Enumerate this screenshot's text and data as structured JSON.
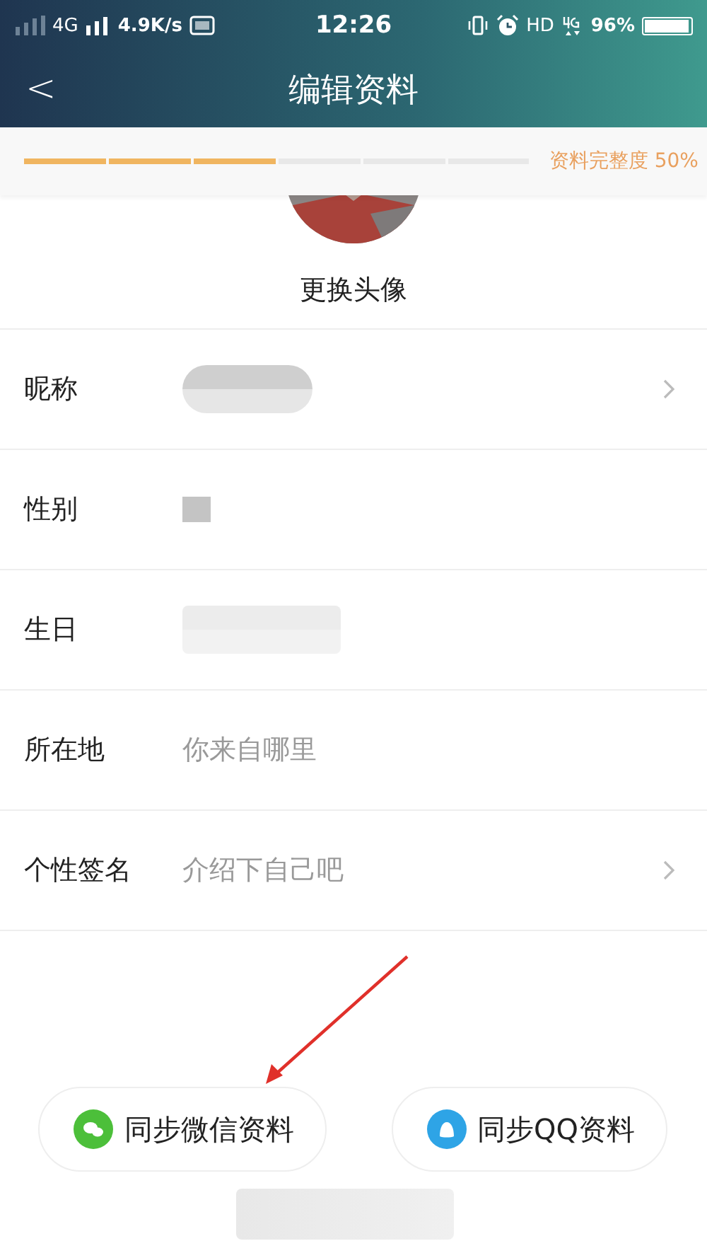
{
  "status_bar": {
    "network": "4G",
    "speed": "4.9K/s",
    "time": "12:26",
    "hd": "HD",
    "battery": "96%"
  },
  "header": {
    "back": "<",
    "title": "编辑资料"
  },
  "progress": {
    "segments": [
      {
        "filled": true
      },
      {
        "filled": true
      },
      {
        "filled": true
      },
      {
        "filled": false
      },
      {
        "filled": false
      },
      {
        "filled": false
      }
    ],
    "label": "资料完整度 50%"
  },
  "avatar": {
    "kind": "picture",
    "caption": "更换头像"
  },
  "fields": [
    {
      "label": "昵称",
      "kind": "blurred",
      "chevron": true
    },
    {
      "label": "性别",
      "kind": "blurred-small",
      "chevron": false
    },
    {
      "label": "生日",
      "kind": "blurred",
      "chevron": false
    },
    {
      "label": "所在地",
      "kind": "placeholder",
      "placeholder": "你来自哪里",
      "chevron": false
    },
    {
      "label": "个性签名",
      "kind": "placeholder",
      "placeholder": "介绍下自己吧",
      "chevron": true
    }
  ],
  "sync_buttons": [
    {
      "kind": "wechat",
      "label": "同步微信资料"
    },
    {
      "kind": "qq",
      "label": "同步QQ资料"
    }
  ]
}
